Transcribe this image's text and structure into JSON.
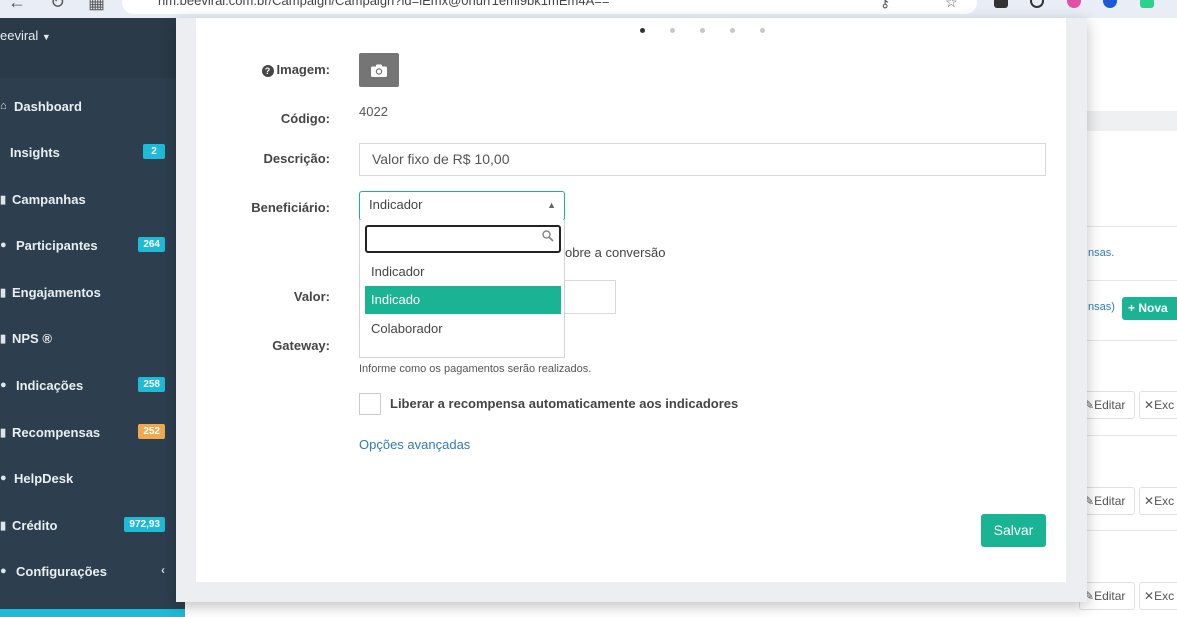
{
  "browser": {
    "url": "nm.beeviral.com.br/Campaign/Campaign?id=lEmx@0hurr1eml9bk1mEm4A=="
  },
  "sidebar": {
    "brand": "eeviral",
    "items": [
      {
        "label": "Dashboard",
        "icon": "home-icon",
        "badge": ""
      },
      {
        "label": "Insights",
        "icon": "lightbulb-icon",
        "badge": "2"
      },
      {
        "label": "Campanhas",
        "icon": "flag-icon",
        "badge": ""
      },
      {
        "label": "Participantes",
        "icon": "users-icon",
        "badge": "264"
      },
      {
        "label": "Engajamentos",
        "icon": "chart-icon",
        "badge": ""
      },
      {
        "label": "NPS ®",
        "icon": "star-icon",
        "badge": ""
      },
      {
        "label": "Indicações",
        "icon": "share-icon",
        "badge": "258"
      },
      {
        "label": "Recompensas",
        "icon": "gift-icon",
        "badge": "252"
      },
      {
        "label": "HelpDesk",
        "icon": "headset-icon",
        "badge": ""
      },
      {
        "label": "Crédito",
        "icon": "credit-card-icon",
        "badge": "972,93"
      },
      {
        "label": "Configurações",
        "icon": "gears-icon",
        "badge": ""
      }
    ],
    "colors": {
      "teal_badge": "#1fbad6",
      "orange_badge": "#f0a94e",
      "bg": "#2d3f4f"
    }
  },
  "background_page": {
    "link_fragment_1": "nsas.",
    "link_fragment_2": "nsas)",
    "nova_button": "Nova",
    "edit_label": "Editar",
    "delete_label": "Exc"
  },
  "modal": {
    "carousel_dots": 5,
    "carousel_active": 1,
    "fields": {
      "imagem_label": "Imagem:",
      "codigo_label": "Código:",
      "codigo_value": "4022",
      "descricao_label": "Descrição:",
      "descricao_value": "Valor fixo de R$ 10,00",
      "beneficiario_label": "Beneficiário:",
      "beneficiario_value": "Indicador",
      "sobre_text": "obre a conversão",
      "valor_label": "Valor:",
      "gateway_label": "Gateway:",
      "gateway_help": "Informe como os pagamentos serão realizados.",
      "liberar_label": "Liberar a recompensa automaticamente aos indicadores",
      "opcoes_link": "Opções avançadas"
    },
    "dropdown": {
      "search_value": "",
      "options": [
        "Indicador",
        "Indicado",
        "Colaborador"
      ],
      "highlighted_index": 1
    },
    "save_button": "Salvar",
    "accent": "#1ab394"
  }
}
